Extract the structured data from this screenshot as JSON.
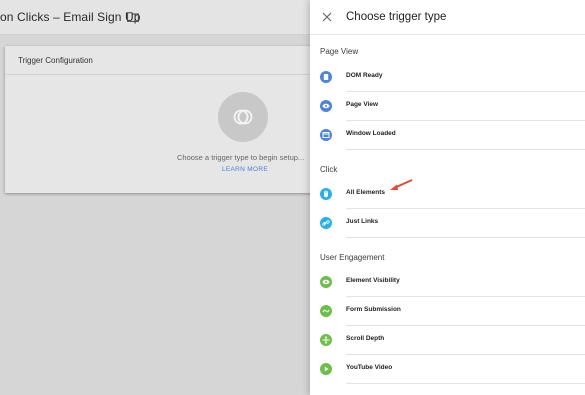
{
  "background": {
    "title": "on Clicks – Email Sign Up",
    "card": {
      "title": "Trigger Configuration",
      "hint": "Choose a trigger type to begin setup...",
      "link": "LEARN MORE"
    }
  },
  "panel": {
    "title": "Choose trigger type",
    "sections": [
      {
        "label": "Page View",
        "items": [
          {
            "label": "DOM Ready",
            "icon": "document-icon",
            "color": "#4a84e0"
          },
          {
            "label": "Page View",
            "icon": "eye-icon",
            "color": "#4a84e0"
          },
          {
            "label": "Window Loaded",
            "icon": "window-icon",
            "color": "#4a84e0"
          }
        ]
      },
      {
        "label": "Click",
        "items": [
          {
            "label": "All Elements",
            "icon": "mouse-icon",
            "color": "#2ab0e8"
          },
          {
            "label": "Just Links",
            "icon": "link-icon",
            "color": "#2ab0e8"
          }
        ]
      },
      {
        "label": "User Engagement",
        "items": [
          {
            "label": "Element Visibility",
            "icon": "eye-icon",
            "color": "#6cc04a"
          },
          {
            "label": "Form Submission",
            "icon": "form-icon",
            "color": "#6cc04a"
          },
          {
            "label": "Scroll Depth",
            "icon": "scroll-icon",
            "color": "#6cc04a"
          },
          {
            "label": "YouTube Video",
            "icon": "play-icon",
            "color": "#6cc04a"
          }
        ]
      }
    ]
  }
}
